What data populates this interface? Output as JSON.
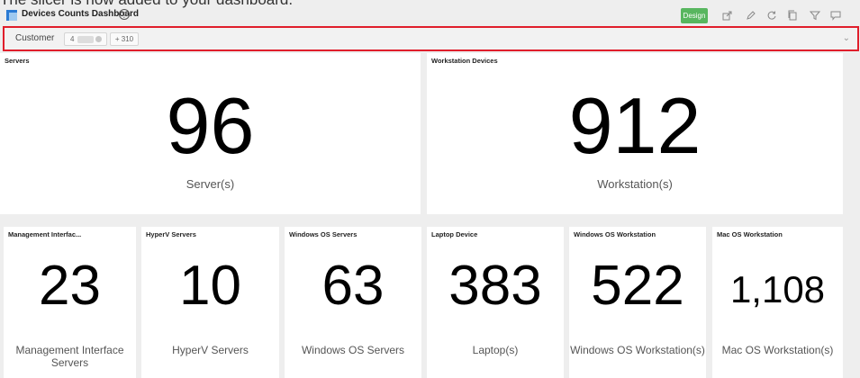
{
  "caption": "The slicer is now added to your dashboard.",
  "dashboard": {
    "title": "Devices Counts Dashboard",
    "help_glyph": "?",
    "design_label": "Design"
  },
  "toolbar_icons": [
    "share-icon",
    "edit-icon",
    "refresh-icon",
    "copy-icon",
    "filter-icon",
    "comment-icon"
  ],
  "slicer": {
    "label": "Customer",
    "chip_prefix": "4",
    "more": "+ 310"
  },
  "cards": [
    {
      "title": "Servers",
      "value": "96",
      "label": "Server(s)"
    },
    {
      "title": "Workstation Devices",
      "value": "912",
      "label": "Workstation(s)"
    },
    {
      "title": "Management Interfac...",
      "value": "23",
      "label": "Management Interface Servers"
    },
    {
      "title": "HyperV Servers",
      "value": "10",
      "label": "HyperV Servers"
    },
    {
      "title": "Windows OS Servers",
      "value": "63",
      "label": "Windows OS Servers"
    },
    {
      "title": "Laptop Device",
      "value": "383",
      "label": "Laptop(s)"
    },
    {
      "title": "Windows OS Workstation",
      "value": "522",
      "label": "Windows OS Workstation(s)"
    },
    {
      "title": "Mac OS Workstation",
      "value": "1,108",
      "label": "Mac OS Workstation(s)"
    }
  ]
}
